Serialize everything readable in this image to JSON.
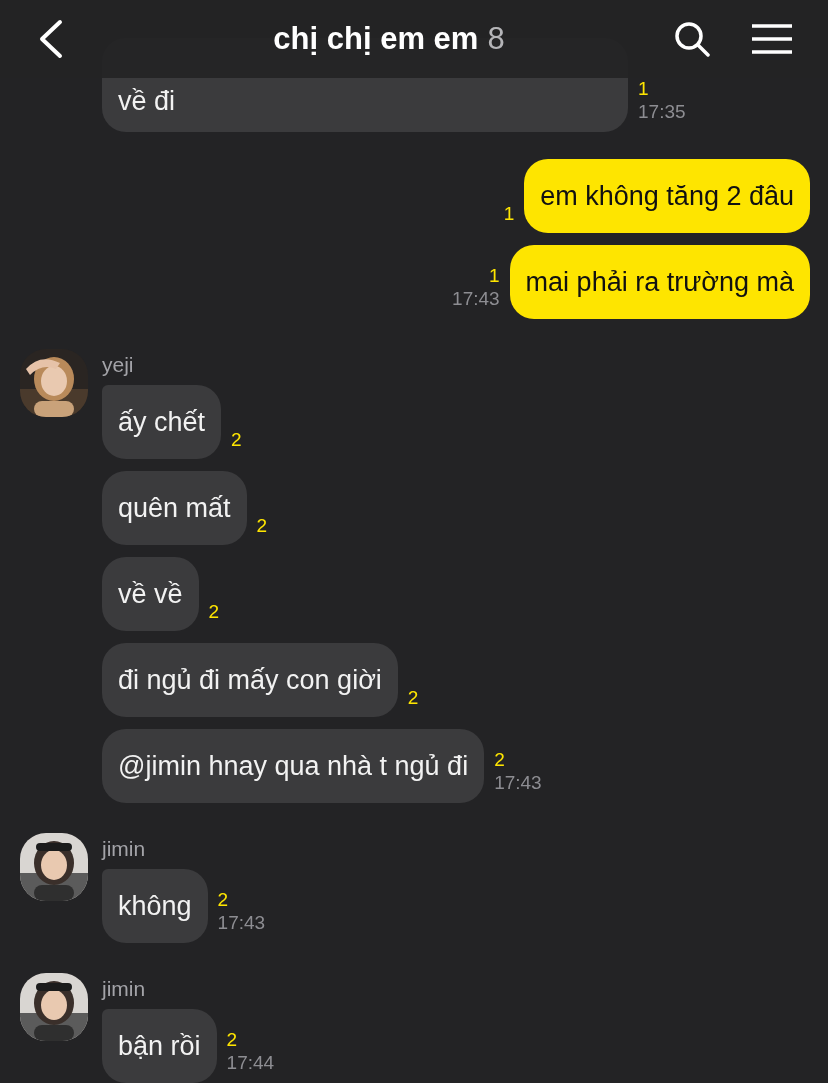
{
  "header": {
    "title": "chị chị em em",
    "member_count": "8"
  },
  "groups": [
    {
      "kind": "incoming",
      "messages": [
        {
          "kind": "covered",
          "text": "về đi",
          "unread": "1",
          "time": "17:35"
        }
      ]
    },
    {
      "kind": "outgoing",
      "messages": [
        {
          "text": "em không tăng 2 đâu",
          "unread": "1"
        },
        {
          "text": "mai phải ra trường mà",
          "unread": "1",
          "time": "17:43"
        }
      ]
    },
    {
      "kind": "incoming",
      "sender": "yeji",
      "avatar": {
        "kind": "picture"
      },
      "messages": [
        {
          "text": "ấy chết",
          "unread": "2"
        },
        {
          "text": "quên mất",
          "unread": "2"
        },
        {
          "text": "về về",
          "unread": "2"
        },
        {
          "text": "đi ngủ đi mấy con giời",
          "unread": "2"
        },
        {
          "text": "@jimin hnay qua nhà t ngủ đi",
          "unread": "2",
          "time": "17:43"
        }
      ]
    },
    {
      "kind": "incoming",
      "sender": "jimin",
      "avatar": {
        "kind": "picture"
      },
      "messages": [
        {
          "text": "không",
          "unread": "2",
          "time": "17:43"
        }
      ]
    },
    {
      "kind": "incoming",
      "sender": "jimin",
      "avatar": {
        "kind": "picture"
      },
      "messages": [
        {
          "text": "bận rồi",
          "unread": "2",
          "time": "17:44"
        }
      ]
    }
  ]
}
